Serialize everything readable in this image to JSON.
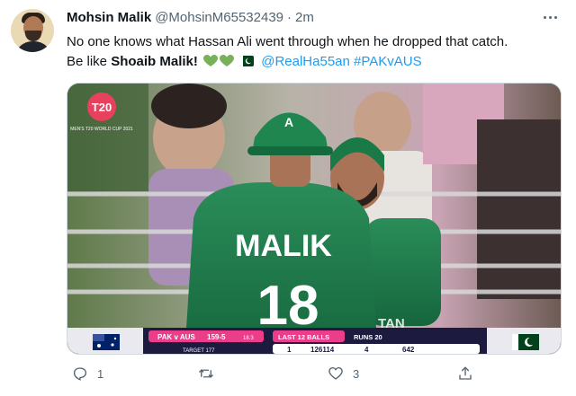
{
  "tweet": {
    "author_name": "Mohsin Malik",
    "author_handle": "@MohsinM65532439",
    "separator": "·",
    "time": "2m",
    "text_line1": "No one knows what Hassan Ali went through when he dropped that catch.",
    "text_line2_prefix": "Be like ",
    "text_line2_bold": "Shoaib Malik!",
    "mention": "@RealHa55an",
    "hashtag": "#PAKvAUS",
    "emoji": [
      "green-heart-icon",
      "green-heart-icon",
      "pakistan-flag-icon"
    ]
  },
  "media": {
    "logo_text": "T20",
    "logo_sub": "MEN'S T20 WORLD CUP 2021",
    "jersey_name": "MALIK",
    "jersey_number": "18",
    "jersey_partial": "TAN",
    "scoreboard": {
      "match": "PAK v AUS",
      "score": "159-5",
      "overs": "18.3",
      "target": "TARGET 177",
      "last_balls_label": "LAST 12 BALLS",
      "runs_label": "RUNS 20",
      "balls_group1": "1",
      "balls_group2": "126114",
      "balls_group3": "4",
      "balls_group4": "642"
    }
  },
  "actions": {
    "reply_count": "1",
    "retweet_count": "",
    "like_count": "3"
  },
  "colors": {
    "link": "#1d9bf0",
    "secondary_text": "#536471",
    "jersey_green": "#1c7a4b"
  }
}
